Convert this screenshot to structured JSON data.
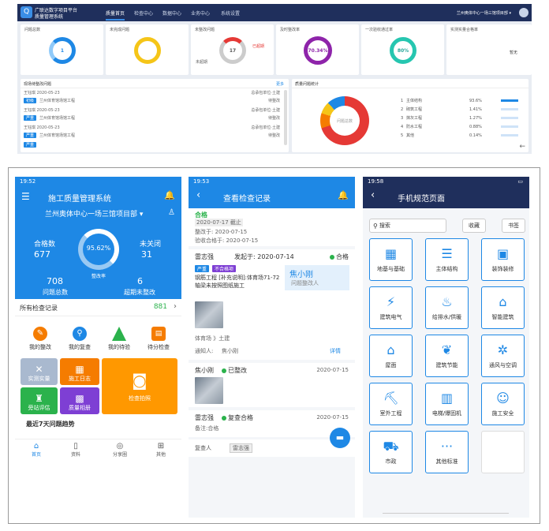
{
  "desktop": {
    "app_title_1": "广联达数字项目平台",
    "app_title_2": "质量管理系统",
    "nav": [
      "质量首页",
      "检查中心",
      "数据中心",
      "业务中心",
      "系统设置"
    ],
    "project": "兰州奥体中心一场三馆项目部 ▾",
    "cards": [
      {
        "label": "问题总数",
        "value": "1"
      },
      {
        "label": "未完成问题",
        "value": ""
      },
      {
        "label": "未整改问题",
        "value": "17",
        "legend_1": "已超期",
        "legend_2": "未超期"
      },
      {
        "label": "及时整改率",
        "value": "70.34%"
      },
      {
        "label": "一次验收通过率",
        "value": "80%"
      },
      {
        "label": "实测实量合格率",
        "value": "暂无"
      }
    ],
    "list_panel": {
      "title": "现场待整改问题",
      "more": "更多",
      "rows": [
        {
          "person": "王钰琪 2020-05-23",
          "dept": "总承包单位·土建",
          "tag": "初级",
          "desc": "兰州体育馆场馆工程",
          "status": "待整改"
        },
        {
          "person": "王钰琪 2020-05-23",
          "dept": "总承包单位·土建",
          "tag": "严重",
          "desc": "兰州体育馆场馆工程",
          "status": "待整改"
        },
        {
          "person": "王钰琪 2020-05-23",
          "dept": "总承包单位·土建",
          "tag": "严重",
          "desc": "兰州体育馆场馆工程",
          "status": "待整改"
        },
        {
          "person": "",
          "dept": "",
          "tag": "严重",
          "desc": "",
          "status": ""
        }
      ]
    },
    "chart_panel": {
      "title": "质量问题统计",
      "center": "问题总数",
      "items": [
        {
          "index": "1",
          "name": "主体结构",
          "value": "93.6%"
        },
        {
          "index": "2",
          "name": "砌筑工程",
          "value": "1.41%"
        },
        {
          "index": "3",
          "name": "抹灰工程",
          "value": "1.27%"
        },
        {
          "index": "4",
          "name": "防水工程",
          "value": "0.88%"
        },
        {
          "index": "5",
          "name": "其他",
          "value": "0.14%"
        }
      ]
    }
  },
  "phone1": {
    "status_time": "19:52",
    "title": "施工质量管理系统",
    "project": "兰州奥体中心一场三馆项目部 ▾",
    "qualified_label": "合格数",
    "qualified_value": "677",
    "unqualified_label": "未关闭",
    "unqualified_value": "31",
    "rate": "95.62%",
    "rate_label": "整改率",
    "issues_value": "708",
    "issues_label": "问题总数",
    "overdue_value": "6",
    "overdue_label": "超期未整改",
    "all_records_label": "所有检查记录",
    "all_records_count": "881",
    "quick": [
      "我的整改",
      "我的复查",
      "我的待验",
      "待分检查"
    ],
    "tiles": [
      "实测实量",
      "施工日志",
      "检查拍照",
      "旁站评估",
      "质量相册"
    ],
    "recent": "最近7天问题趋势",
    "tabs": [
      "首页",
      "资料",
      "分享圈",
      "其他"
    ]
  },
  "phone2": {
    "status_time": "19:53",
    "title": "查看检查记录",
    "status": "合格",
    "deadline": "2020-07-17 截止",
    "inspect_date": "整改于: 2020-07-15",
    "review_date": "验收合格于: 2020-07-15",
    "inspector": "雷志强",
    "sent": "发起于: 2020-07-14",
    "result": "合格",
    "tag1": "严重",
    "tag2": "不合格项",
    "desc": "钢筋工程 [补充说明]:体育场71-72轴梁未按照图纸施工",
    "assignee": "焦小刚",
    "assignee_role": "问题整改人",
    "location": "体育场 》土建",
    "notify": "通知人:",
    "notify_person": "焦小刚",
    "detail": "详情",
    "r1_name": "焦小刚",
    "r1_status": "已整改",
    "r1_date": "2020-07-15",
    "r2_name": "雷志强",
    "r2_status": "复查合格",
    "r2_date": "2020-07-15",
    "remark": "备注:合格",
    "reviewer_label": "复查人",
    "reviewer": "雷志强"
  },
  "phone3": {
    "status_time": "19:58",
    "title": "手机规范页面",
    "search_placeholder": "搜索",
    "fav": "收藏",
    "bookmark": "书签",
    "grid": [
      {
        "label": "地基与基础",
        "icon": "▦"
      },
      {
        "label": "主体结构",
        "icon": "☰"
      },
      {
        "label": "装饰装修",
        "icon": "▣"
      },
      {
        "label": "建筑电气",
        "icon": "⚡"
      },
      {
        "label": "给排水/供暖",
        "icon": "♨"
      },
      {
        "label": "智能建筑",
        "icon": "⌂"
      },
      {
        "label": "屋面",
        "icon": "⌂"
      },
      {
        "label": "建筑节能",
        "icon": "❦"
      },
      {
        "label": "通风与空调",
        "icon": "✲"
      },
      {
        "label": "室外工程",
        "icon": "⛏"
      },
      {
        "label": "电梯/爆固机",
        "icon": "▥"
      },
      {
        "label": "施工安全",
        "icon": "☺"
      },
      {
        "label": "市政",
        "icon": "⛟"
      },
      {
        "label": "其他标准",
        "icon": "···"
      }
    ]
  }
}
